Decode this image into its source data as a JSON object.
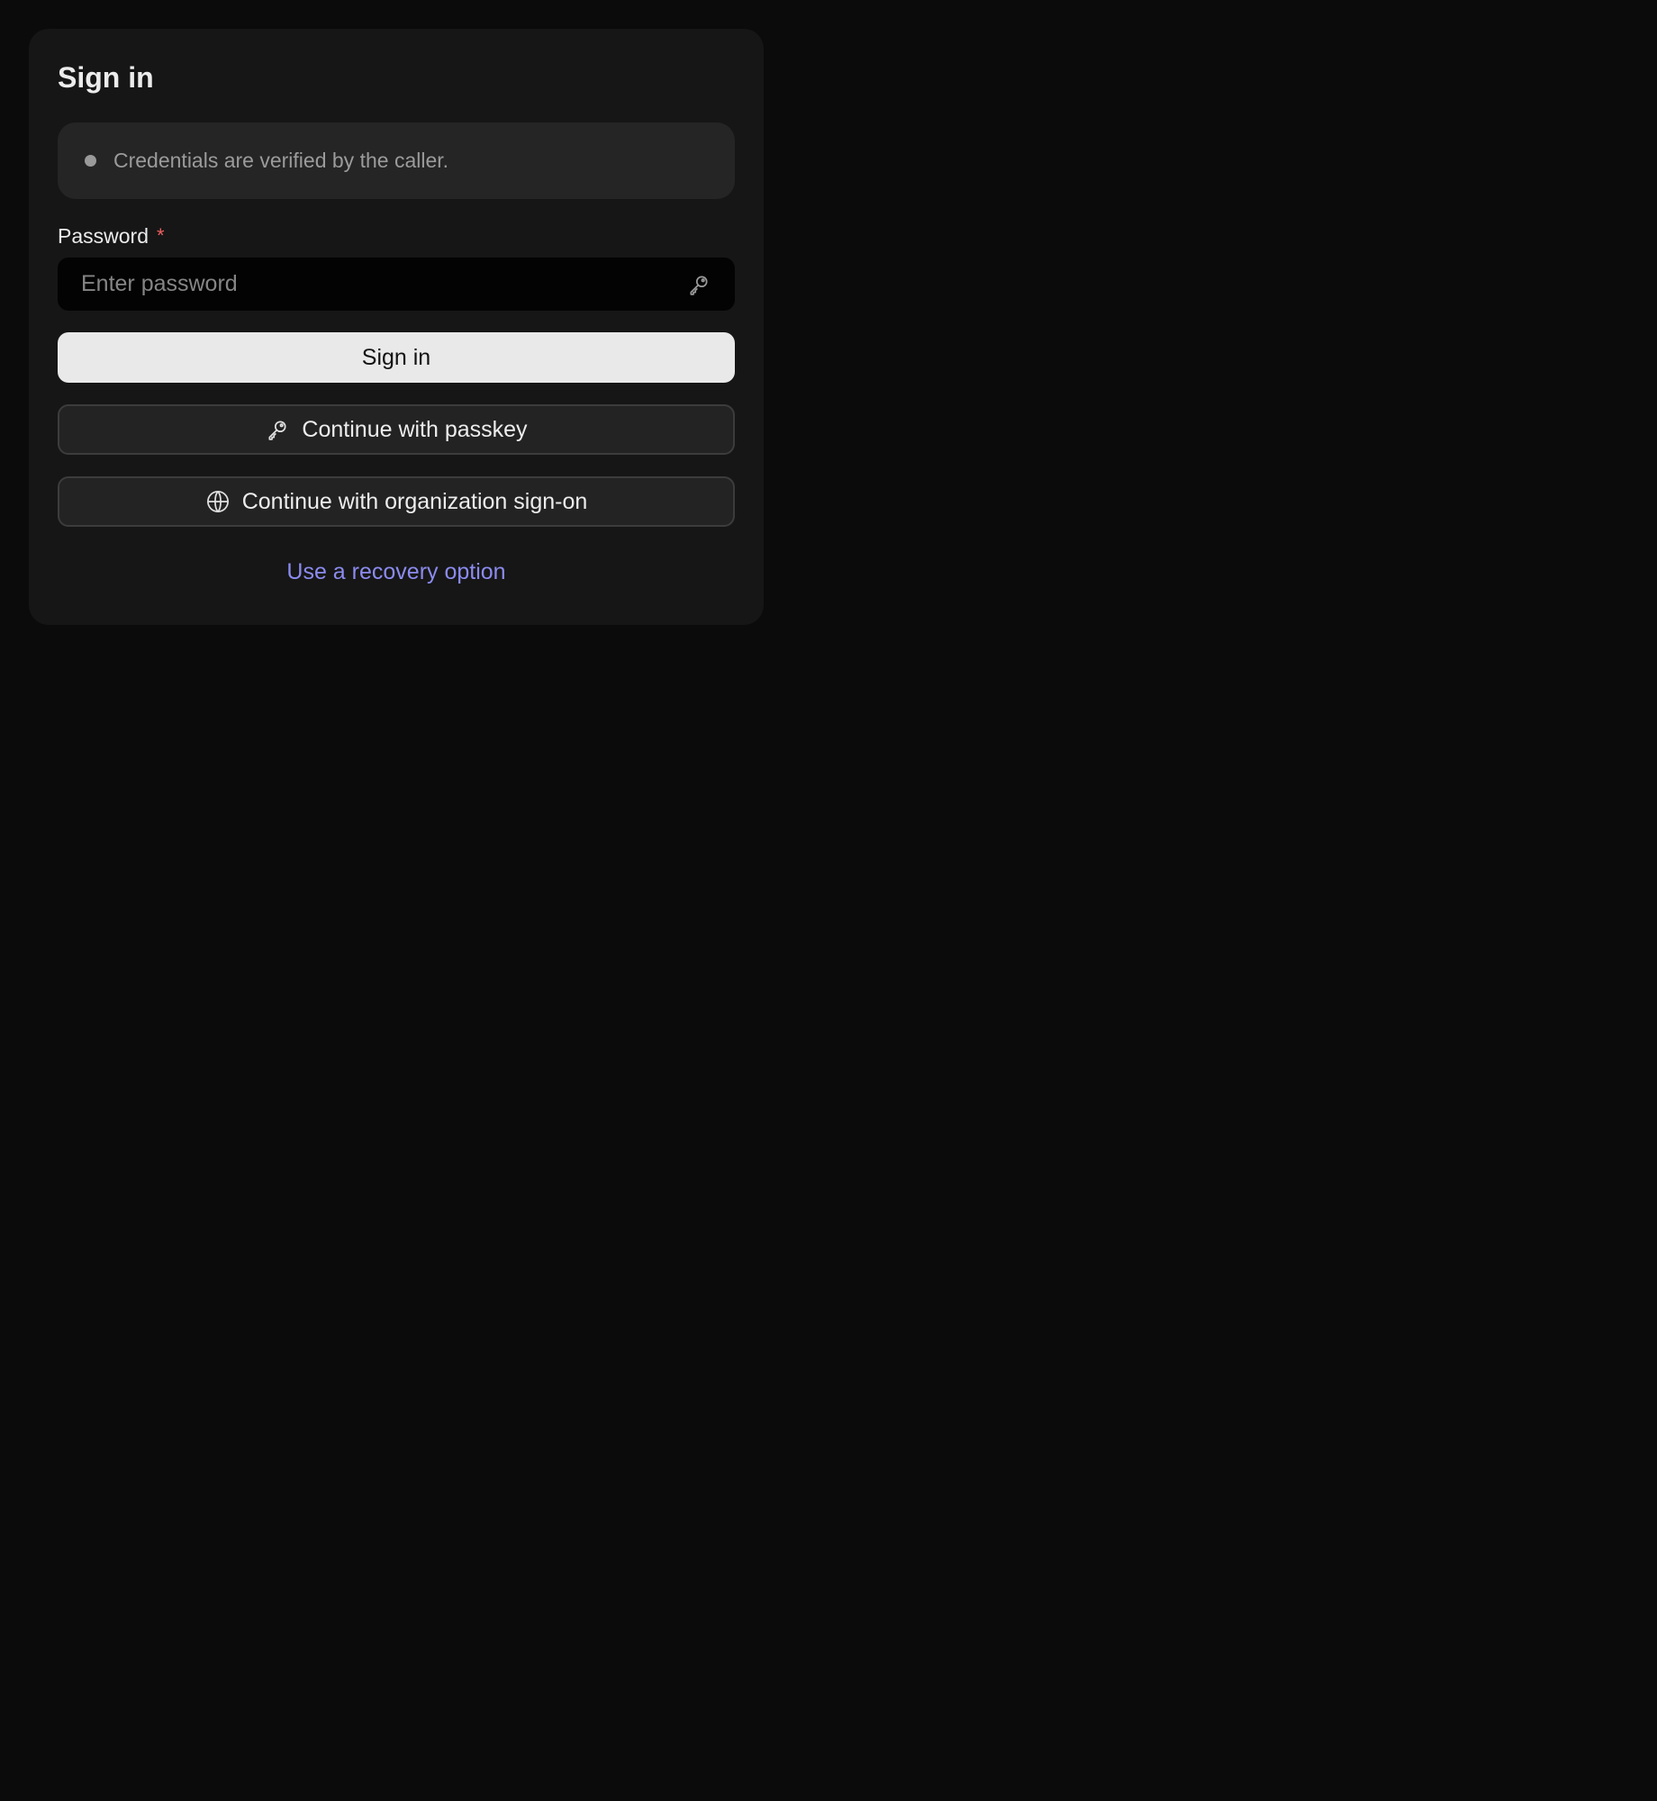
{
  "signin": {
    "title": "Sign in",
    "notice": "Credentials are verified by the caller.",
    "password": {
      "label": "Password",
      "required_mark": "*",
      "placeholder": "Enter password",
      "value": ""
    },
    "submit_label": "Sign in",
    "passkey_label": "Continue with passkey",
    "sso_label": "Continue with organization sign-on",
    "recovery_label": "Use a recovery option"
  },
  "icons": {
    "password_field": "key-icon",
    "passkey_button": "key-icon",
    "sso_button": "globe-icon",
    "notice": "bullet-dot"
  },
  "colors": {
    "page_background": "#0b0b0b",
    "card_background": "#161616",
    "primary_button": "#e9e9e9",
    "link": "#8b8bf0",
    "required": "#ef5f5f"
  }
}
